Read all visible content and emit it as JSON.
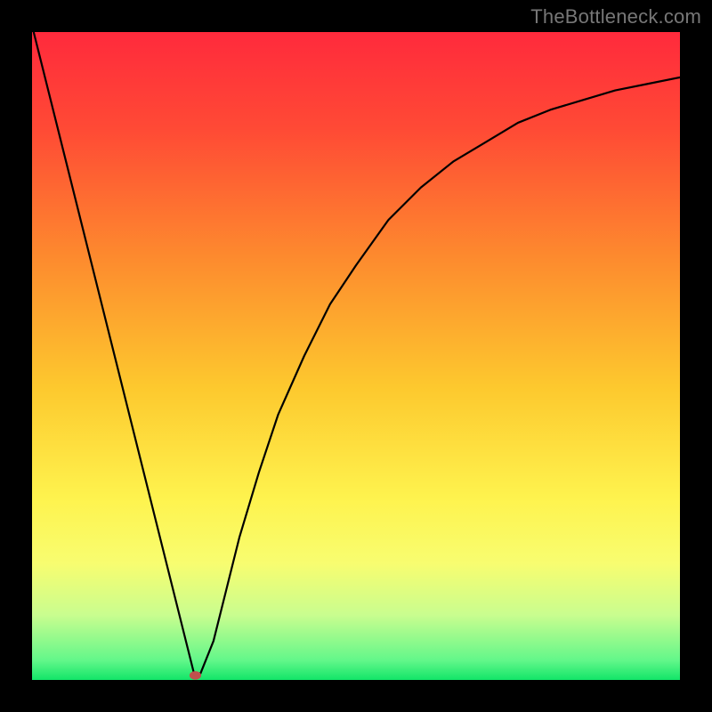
{
  "watermark": "TheBottleneck.com",
  "chart_data": {
    "type": "line",
    "title": "",
    "xlabel": "",
    "ylabel": "",
    "xlim": [
      0,
      100
    ],
    "ylim": [
      0,
      100
    ],
    "x": [
      0,
      5,
      10,
      15,
      20,
      22,
      24,
      25,
      26,
      28,
      30,
      32,
      35,
      38,
      42,
      46,
      50,
      55,
      60,
      65,
      70,
      75,
      80,
      85,
      90,
      95,
      100
    ],
    "y": [
      101,
      81,
      61,
      41,
      21,
      13,
      5,
      1,
      1,
      6,
      14,
      22,
      32,
      41,
      50,
      58,
      64,
      71,
      76,
      80,
      83,
      86,
      88,
      89.5,
      91,
      92,
      93
    ],
    "marker": {
      "x": 25.2,
      "y": 0.7,
      "color": "#c0504d"
    },
    "gradient_stops": [
      {
        "offset": 0.0,
        "color": "#ff2a3c"
      },
      {
        "offset": 0.15,
        "color": "#ff4a35"
      },
      {
        "offset": 0.35,
        "color": "#fd8b2e"
      },
      {
        "offset": 0.55,
        "color": "#fdc92e"
      },
      {
        "offset": 0.72,
        "color": "#fef34e"
      },
      {
        "offset": 0.82,
        "color": "#f8fd70"
      },
      {
        "offset": 0.9,
        "color": "#c9fd8f"
      },
      {
        "offset": 0.97,
        "color": "#62f78a"
      },
      {
        "offset": 1.0,
        "color": "#12e568"
      }
    ]
  }
}
